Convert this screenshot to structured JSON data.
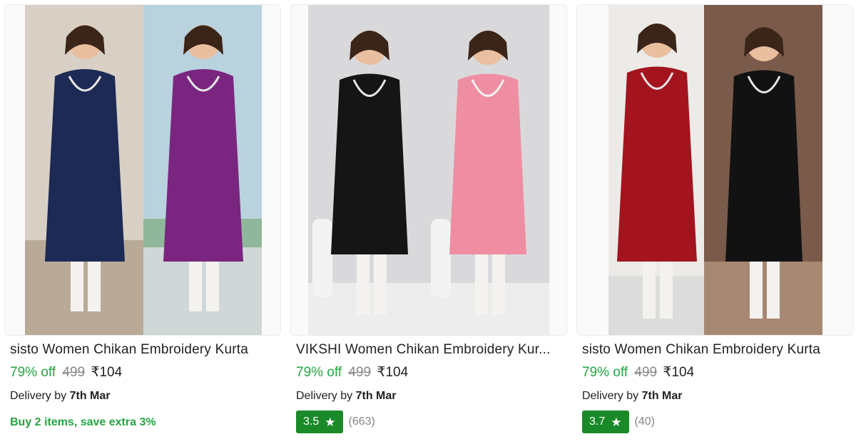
{
  "products": [
    {
      "title": "sisto Women Chikan Embroidery Kurta",
      "discount": "79% off",
      "mrp": "499",
      "price": "₹104",
      "delivery_prefix": "Delivery by",
      "delivery_date": "7th Mar",
      "offer": "Buy 2 items, save extra 3%",
      "image": {
        "left_color": "#1d2a55",
        "right_color": "#7a2680",
        "bg_left": "#d8d0c4",
        "bg_right": "#b8d2de"
      }
    },
    {
      "title": "VIKSHI Women Chikan Embroidery Kur...",
      "discount": "79% off",
      "mrp": "499",
      "price": "₹104",
      "delivery_prefix": "Delivery by",
      "delivery_date": "7th Mar",
      "rating": "3.5",
      "rating_count": "(663)",
      "image": {
        "left_color": "#151515",
        "right_color": "#ef8ea2",
        "bg_left": "#d9d9db",
        "bg_right": "#d9d9db"
      }
    },
    {
      "title": "sisto Women Chikan Embroidery Kurta",
      "discount": "79% off",
      "mrp": "499",
      "price": "₹104",
      "delivery_prefix": "Delivery by",
      "delivery_date": "7th Mar",
      "rating": "3.7",
      "rating_count": "(40)",
      "image": {
        "left_color": "#a3141e",
        "right_color": "#121212",
        "bg_left": "#ecebe7",
        "bg_right": "#7a5a4a"
      }
    }
  ],
  "icons": {
    "star": "star-icon"
  },
  "colors": {
    "discount_green": "#26a541",
    "rating_green": "#1a8a28",
    "strike_grey": "#878787"
  }
}
